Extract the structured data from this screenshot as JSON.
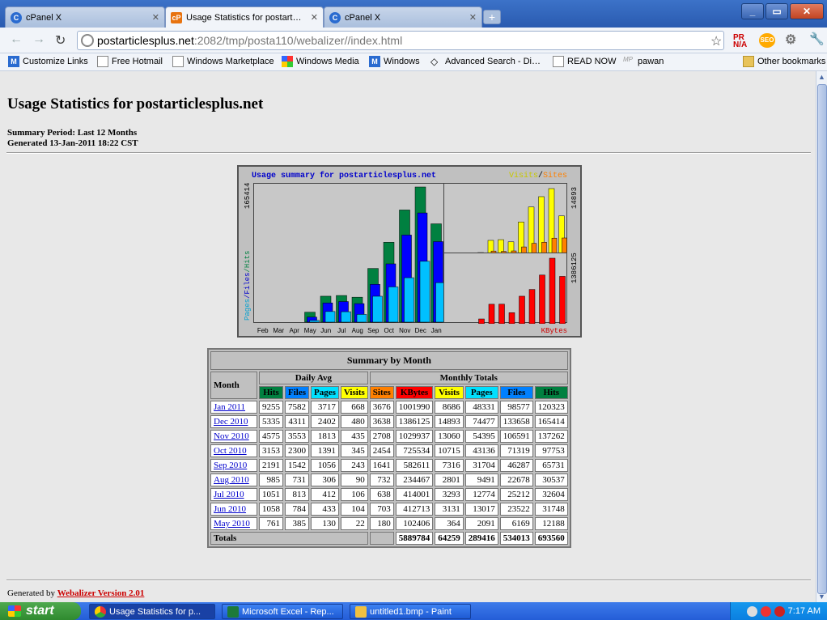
{
  "browser": {
    "tabs": [
      {
        "label": "cPanel X",
        "icon": "cpanel-icon"
      },
      {
        "label": "Usage Statistics for postart…",
        "icon": "cp-icon",
        "active": true
      },
      {
        "label": "cPanel X",
        "icon": "cpanel-icon"
      }
    ],
    "url_host": "postarticlesplus.net",
    "url_rest": ":2082/tmp/posta110/webalizer//index.html",
    "ext_pr": "PR N/A",
    "ext_seo": "SEO",
    "bookmarks": [
      "Customize Links",
      "Free Hotmail",
      "Windows Marketplace",
      "Windows Media",
      "Windows",
      "Advanced Search - Di…",
      "READ NOW",
      "pawan"
    ],
    "other_bookmarks": "Other bookmarks"
  },
  "page": {
    "title": "Usage Statistics for postarticlesplus.net",
    "summary_period": "Summary Period: Last 12 Months",
    "generated": "Generated 13-Jan-2011 18:22 CST",
    "footer_prefix": "Generated by",
    "footer_link": "Webalizer Version 2.01"
  },
  "graph": {
    "title": "Usage summary for postarticlesplus.net",
    "legend_visits": "Visits",
    "legend_slash": "/",
    "legend_sites": "Sites",
    "y_left_max": "165414",
    "y_left_label_pages": "Pages",
    "y_left_label_files": "/Files",
    "y_left_label_hits": "/Hits",
    "y_right_top_max": "14893",
    "y_right_bottom_max": "1386125",
    "kbytes_label": "KBytes",
    "months": [
      "Feb",
      "Mar",
      "Apr",
      "May",
      "Jun",
      "Jul",
      "Aug",
      "Sep",
      "Oct",
      "Nov",
      "Dec",
      "Jan"
    ],
    "colors": {
      "hits": "#008040",
      "files": "#0000ff",
      "pages": "#00c0ff",
      "visits": "#ffff00",
      "sites": "#ff8000",
      "kbytes": "#ff0000"
    }
  },
  "chart_data": {
    "type": "bar",
    "title": "Usage summary for postarticlesplus.net",
    "categories": [
      "Feb",
      "Mar",
      "Apr",
      "May",
      "Jun",
      "Jul",
      "Aug",
      "Sep",
      "Oct",
      "Nov",
      "Dec",
      "Jan"
    ],
    "series": [
      {
        "name": "Hits",
        "values": [
          0,
          0,
          0,
          12188,
          31748,
          32604,
          30537,
          65731,
          97753,
          137262,
          165414,
          120323
        ]
      },
      {
        "name": "Files",
        "values": [
          0,
          0,
          0,
          6169,
          23522,
          25212,
          22678,
          46287,
          71319,
          106591,
          133658,
          98577
        ]
      },
      {
        "name": "Pages",
        "values": [
          0,
          0,
          0,
          2091,
          13017,
          12774,
          9491,
          31704,
          43136,
          54395,
          74477,
          48331
        ]
      },
      {
        "name": "Visits",
        "values": [
          0,
          0,
          0,
          364,
          3131,
          3293,
          2801,
          7316,
          10715,
          13060,
          14893,
          8686
        ]
      },
      {
        "name": "Sites",
        "values": [
          0,
          0,
          0,
          180,
          703,
          638,
          732,
          1641,
          2454,
          2708,
          3638,
          3676
        ]
      },
      {
        "name": "KBytes",
        "values": [
          0,
          0,
          0,
          102406,
          412713,
          414001,
          234467,
          582611,
          725534,
          1029937,
          1386125,
          1001990
        ]
      }
    ]
  },
  "table": {
    "caption": "Summary by Month",
    "month_header": "Month",
    "daily_avg_header": "Daily Avg",
    "monthly_totals_header": "Monthly Totals",
    "daily_cols": [
      "Hits",
      "Files",
      "Pages",
      "Visits"
    ],
    "monthly_cols": [
      "Sites",
      "KBytes",
      "Visits",
      "Pages",
      "Files",
      "Hits"
    ],
    "rows": [
      {
        "month": "Jan 2011",
        "d": [
          "9255",
          "7582",
          "3717",
          "668"
        ],
        "m": [
          "3676",
          "1001990",
          "8686",
          "48331",
          "98577",
          "120323"
        ]
      },
      {
        "month": "Dec 2010",
        "d": [
          "5335",
          "4311",
          "2402",
          "480"
        ],
        "m": [
          "3638",
          "1386125",
          "14893",
          "74477",
          "133658",
          "165414"
        ]
      },
      {
        "month": "Nov 2010",
        "d": [
          "4575",
          "3553",
          "1813",
          "435"
        ],
        "m": [
          "2708",
          "1029937",
          "13060",
          "54395",
          "106591",
          "137262"
        ]
      },
      {
        "month": "Oct 2010",
        "d": [
          "3153",
          "2300",
          "1391",
          "345"
        ],
        "m": [
          "2454",
          "725534",
          "10715",
          "43136",
          "71319",
          "97753"
        ]
      },
      {
        "month": "Sep 2010",
        "d": [
          "2191",
          "1542",
          "1056",
          "243"
        ],
        "m": [
          "1641",
          "582611",
          "7316",
          "31704",
          "46287",
          "65731"
        ]
      },
      {
        "month": "Aug 2010",
        "d": [
          "985",
          "731",
          "306",
          "90"
        ],
        "m": [
          "732",
          "234467",
          "2801",
          "9491",
          "22678",
          "30537"
        ]
      },
      {
        "month": "Jul 2010",
        "d": [
          "1051",
          "813",
          "412",
          "106"
        ],
        "m": [
          "638",
          "414001",
          "3293",
          "12774",
          "25212",
          "32604"
        ]
      },
      {
        "month": "Jun 2010",
        "d": [
          "1058",
          "784",
          "433",
          "104"
        ],
        "m": [
          "703",
          "412713",
          "3131",
          "13017",
          "23522",
          "31748"
        ]
      },
      {
        "month": "May 2010",
        "d": [
          "761",
          "385",
          "130",
          "22"
        ],
        "m": [
          "180",
          "102406",
          "364",
          "2091",
          "6169",
          "12188"
        ]
      }
    ],
    "totals_label": "Totals",
    "totals": [
      "5889784",
      "64259",
      "289416",
      "534013",
      "693560"
    ]
  },
  "taskbar": {
    "start": "start",
    "tasks": [
      "Usage Statistics for p...",
      "Microsoft Excel - Rep...",
      "untitled1.bmp - Paint"
    ],
    "clock": "7:17 AM"
  }
}
